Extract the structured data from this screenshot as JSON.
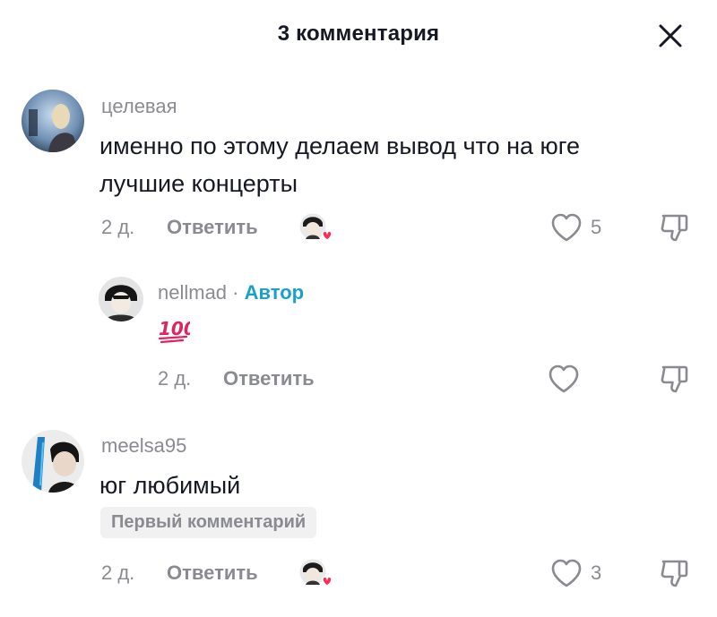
{
  "header": {
    "title": "3 комментария"
  },
  "comments": [
    {
      "username": "целевая",
      "text_line1": "именно по этому делаем вывод что на юге",
      "text_line2": "лучшие концерты",
      "time": "2 д.",
      "reply_label": "Ответить",
      "likes": "5"
    },
    {
      "username": "nellmad",
      "separator": " · ",
      "author_label": "Автор",
      "emoji": "100",
      "time": "2 д.",
      "reply_label": "Ответить"
    },
    {
      "username": "meelsa95",
      "text": "юг любимый",
      "badge": "Первый комментарий",
      "time": "2 д.",
      "reply_label": "Ответить",
      "likes": "3"
    }
  ],
  "icons": {
    "close": "close-icon",
    "heart": "heart-outline-icon",
    "dislike": "thumb-down-icon",
    "liked_by_creator": "creator-liked-avatar-icon"
  },
  "colors": {
    "text": "#161823",
    "muted": "#8a8b91",
    "author": "#1aa0c9",
    "heart_red": "#fe2c55",
    "badge_bg": "#f1f1f2"
  }
}
